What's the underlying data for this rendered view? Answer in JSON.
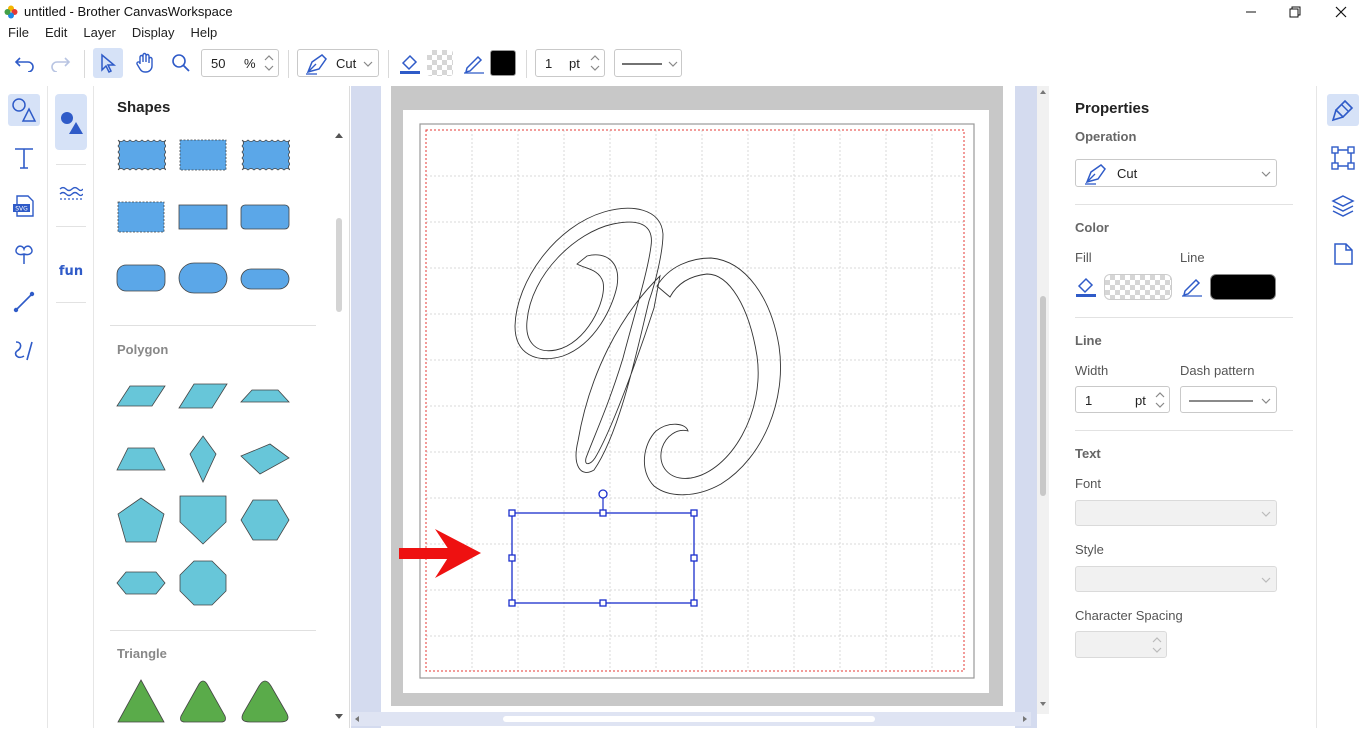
{
  "window": {
    "title": "untitled - Brother CanvasWorkspace"
  },
  "menu": [
    "File",
    "Edit",
    "Layer",
    "Display",
    "Help"
  ],
  "toolbar": {
    "zoom_value": "50",
    "zoom_unit": "%",
    "operation_label": "Cut",
    "line_width_value": "1",
    "line_width_unit": "pt",
    "line_color": "#000000"
  },
  "shapes_panel": {
    "title": "Shapes",
    "sections": [
      "Polygon",
      "Triangle"
    ],
    "shape_color_basic": "#5ba7e8",
    "shape_color_polygon": "#67c6d9",
    "shape_color_triangle": "#5aab4a"
  },
  "canvas": {
    "grid_color": "#d8d8d8",
    "cut_area_color": "#e53935",
    "selection_color": "#1a2ecc",
    "annotation_arrow_color": "#ee1111"
  },
  "properties": {
    "title": "Properties",
    "operation_section": "Operation",
    "operation_value": "Cut",
    "color_section": "Color",
    "fill_label": "Fill",
    "line_label": "Line",
    "line_color": "#000000",
    "line_section": "Line",
    "width_label": "Width",
    "width_value": "1",
    "width_unit": "pt",
    "dash_label": "Dash pattern",
    "text_section": "Text",
    "font_label": "Font",
    "style_label": "Style",
    "char_spacing_label": "Character Spacing"
  }
}
